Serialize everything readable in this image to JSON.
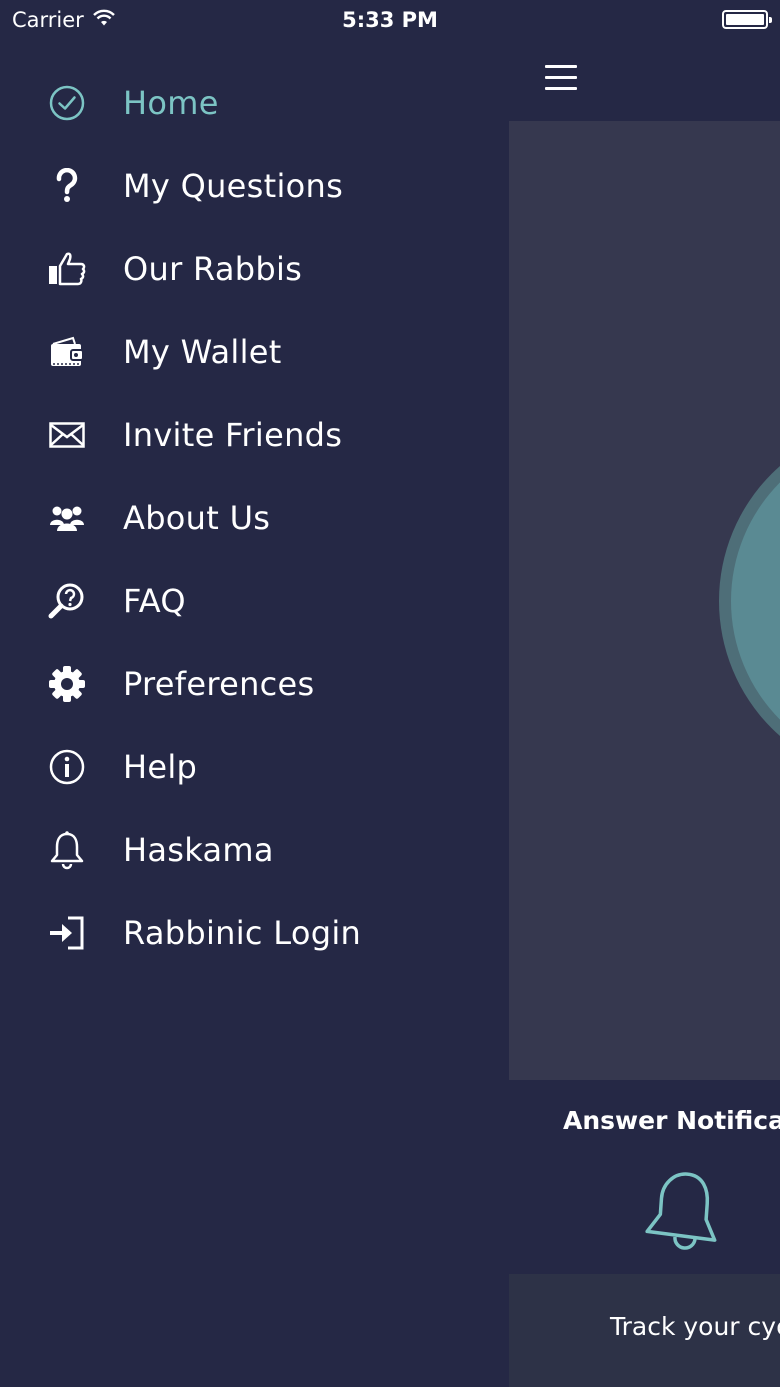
{
  "status_bar": {
    "carrier": "Carrier",
    "time": "5:33 PM"
  },
  "drawer": {
    "items": [
      {
        "label": "Home",
        "icon": "check-circle-icon",
        "active": true
      },
      {
        "label": "My Questions",
        "icon": "question-icon"
      },
      {
        "label": "Our Rabbis",
        "icon": "thumbs-up-icon"
      },
      {
        "label": "My Wallet",
        "icon": "wallet-icon"
      },
      {
        "label": "Invite Friends",
        "icon": "envelope-icon"
      },
      {
        "label": "About Us",
        "icon": "people-icon"
      },
      {
        "label": "FAQ",
        "icon": "search-question-icon"
      },
      {
        "label": "Preferences",
        "icon": "gear-icon"
      },
      {
        "label": "Help",
        "icon": "info-icon"
      },
      {
        "label": "Haskama",
        "icon": "bell-icon"
      },
      {
        "label": "Rabbinic Login",
        "icon": "login-icon"
      }
    ]
  },
  "main": {
    "menu_icon": "hamburger-icon",
    "notification_title": "Answer Notificat",
    "notification_icon": "bell-icon",
    "track_text": "Track your cyc"
  },
  "colors": {
    "background": "#252845",
    "content": "#36384f",
    "accent": "#7cc4c4"
  }
}
